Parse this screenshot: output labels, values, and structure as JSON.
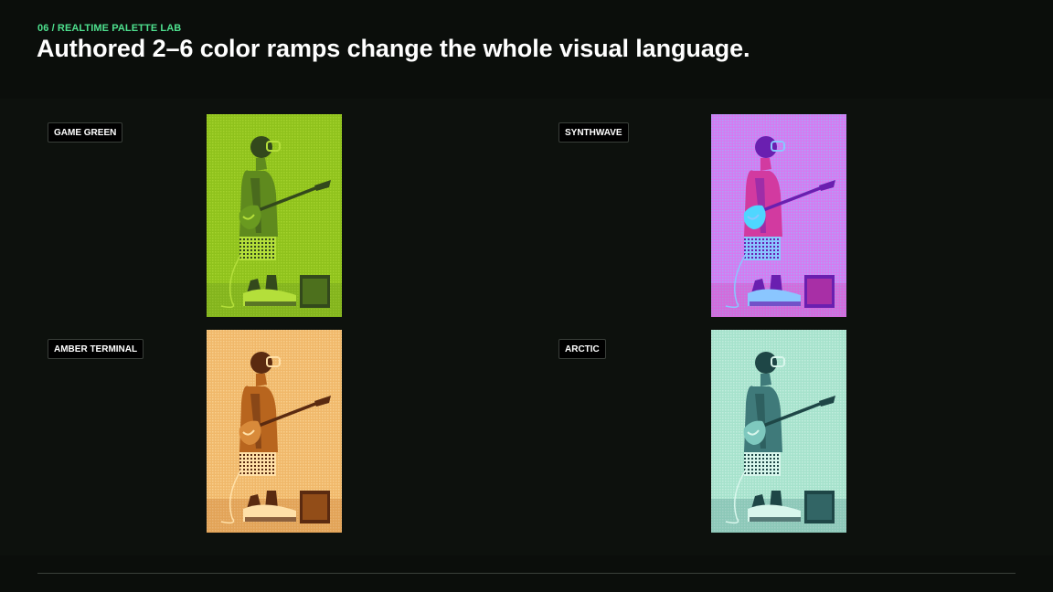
{
  "header": {
    "eyebrow": "06 / REALTIME PALETTE LAB",
    "headline": "Authored 2–6 color ramps change the whole visual language.",
    "accent": "#4ee08e"
  },
  "palettes": [
    {
      "label": "GAME GREEN",
      "bg": "#8fc21c",
      "light": "#b4df3a",
      "mid": "#5f8a1e",
      "dark": "#33491c",
      "accent": "#6a9a20"
    },
    {
      "label": "SYNTHWAVE",
      "bg": "#d57af0",
      "light": "#8ac6ff",
      "mid": "#d23aa0",
      "dark": "#6a1fb0",
      "accent": "#4fd6ff"
    },
    {
      "label": "AMBER TERMINAL",
      "bg": "#f0b86a",
      "light": "#ffe0a8",
      "mid": "#b8651e",
      "dark": "#5a2a10",
      "accent": "#d88a3a"
    },
    {
      "label": "ARCTIC",
      "bg": "#a6e2cc",
      "light": "#d8f6ec",
      "mid": "#3f7a7a",
      "dark": "#1e4646",
      "accent": "#7ec8be"
    }
  ]
}
